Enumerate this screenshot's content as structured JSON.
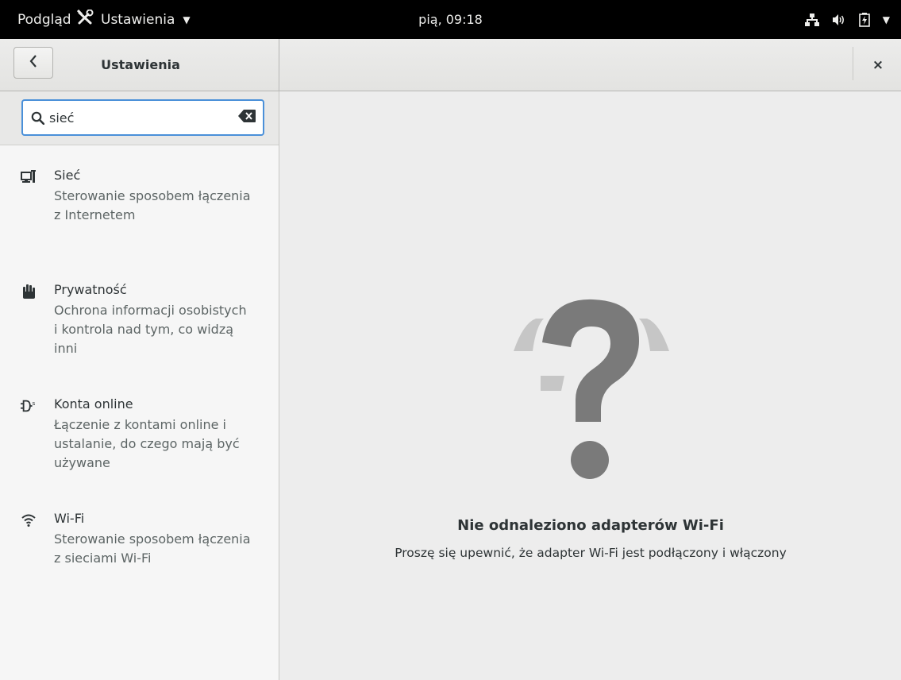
{
  "topbar": {
    "overview_label": "Podgląd",
    "app_menu_label": "Ustawienia",
    "clock": "pią, 09:18",
    "status_icons": [
      "network-wired-icon",
      "volume-icon",
      "battery-charging-icon",
      "system-menu-arrow-icon"
    ]
  },
  "header": {
    "title": "Ustawienia",
    "back_icon": "chevron-left-icon",
    "close_label": "×"
  },
  "search": {
    "value": "sieć",
    "icon": "search-icon",
    "clear_icon": "clear-text-icon"
  },
  "results": [
    {
      "icon": "network-icon",
      "title": "Sieć",
      "description": "Sterowanie sposobem łączenia z Internetem"
    },
    {
      "icon": "privacy-hand-icon",
      "title": "Prywatność",
      "description": "Ochrona informacji osobistych i kontrola nad tym, co widzą inni"
    },
    {
      "icon": "online-accounts-icon",
      "title": "Konta online",
      "description": "Łączenie z kontami online i ustalanie, do czego mają być używane"
    },
    {
      "icon": "wifi-icon",
      "title": "Wi-Fi",
      "description": "Sterowanie sposobem łączenia z sieciami Wi-Fi"
    }
  ],
  "main": {
    "empty_icon": "question-mark-icon",
    "title": "Nie odnaleziono adapterów Wi-Fi",
    "subtitle": "Proszę się upewnić, że adapter Wi-Fi jest podłączony i włączony"
  },
  "colors": {
    "topbar_bg": "#000000",
    "accent": "#4a90d9",
    "placeholder_icon": "#7a7a7a",
    "placeholder_icon_light": "#c4c4c4"
  }
}
